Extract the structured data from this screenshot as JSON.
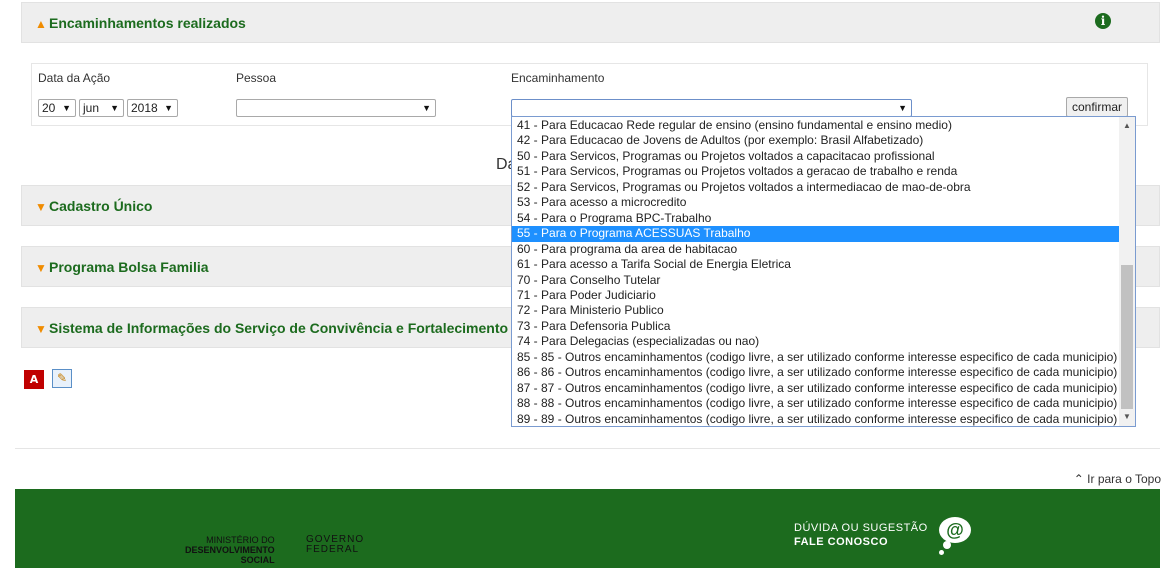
{
  "panels": {
    "encaminhamentos_title": "Encaminhamentos realizados",
    "cadastro_title": "Cadastro Único",
    "bolsa_title": "Programa Bolsa Familia",
    "sistema_title": "Sistema de Informações do Serviço de Convivência e Fortalecimento"
  },
  "icons": {
    "expanded_chevron": "^",
    "collapsed_chevron": "v",
    "info": "i",
    "pdf": "pdf-icon",
    "edit": "edit-icon"
  },
  "form": {
    "label_data": "Data da Ação",
    "label_pessoa": "Pessoa",
    "label_encaminhamento": "Encaminhamento",
    "day_value": "20",
    "month_value": "jun",
    "year_value": "2018",
    "pessoa_value": "",
    "encaminhamento_value": "",
    "confirm_label": "confirmar"
  },
  "ghost_text": "Da",
  "dropdown": {
    "selected_index": 7,
    "options": [
      "41 - Para Educacao Rede regular de ensino (ensino fundamental e ensino medio)",
      "42 - Para Educacao de Jovens de Adultos (por exemplo: Brasil Alfabetizado)",
      "50 - Para Servicos, Programas ou Projetos voltados a capacitacao profissional",
      "51 - Para Servicos, Programas ou Projetos voltados a geracao de trabalho e renda",
      "52 - Para Servicos, Programas ou Projetos voltados a intermediacao de mao-de-obra",
      "53 - Para acesso a microcredito",
      "54 - Para o Programa BPC-Trabalho",
      "55 - Para o Programa ACESSUAS Trabalho",
      "60 - Para programa da area de habitacao",
      "61 - Para acesso a Tarifa Social de Energia Eletrica",
      "70 - Para Conselho Tutelar",
      "71 - Para Poder Judiciario",
      "72 - Para Ministerio Publico",
      "73 - Para Defensoria Publica",
      "74 - Para Delegacias (especializadas ou nao)",
      "85 - 85 - Outros encaminhamentos (codigo livre, a ser utilizado conforme interesse especifico de cada municipio)",
      "86 - 86 - Outros encaminhamentos (codigo livre, a ser utilizado conforme interesse especifico de cada municipio)",
      "87 - 87 - Outros encaminhamentos (codigo livre, a ser utilizado conforme interesse especifico de cada municipio)",
      "88 - 88 - Outros encaminhamentos (codigo livre, a ser utilizado conforme interesse especifico de cada municipio)",
      "89 - 89 - Outros encaminhamentos (codigo livre, a ser utilizado conforme interesse especifico de cada municipio)"
    ]
  },
  "top_link": "Ir para o Topo",
  "footer": {
    "mds_line1": "MINISTÉRIO DO",
    "mds_line2": "DESENVOLVIMENTO",
    "mds_line3": "SOCIAL",
    "gov_line1": "GOVERNO",
    "gov_line2": "FEDERAL",
    "duvida_line1": "DÚVIDA OU SUGESTÃO",
    "duvida_line2": "FALE CONOSCO",
    "at_symbol": "@"
  },
  "colors": {
    "brand_green": "#1c6b1e",
    "accent_orange": "#f08c00",
    "selection_blue": "#1e90ff"
  }
}
